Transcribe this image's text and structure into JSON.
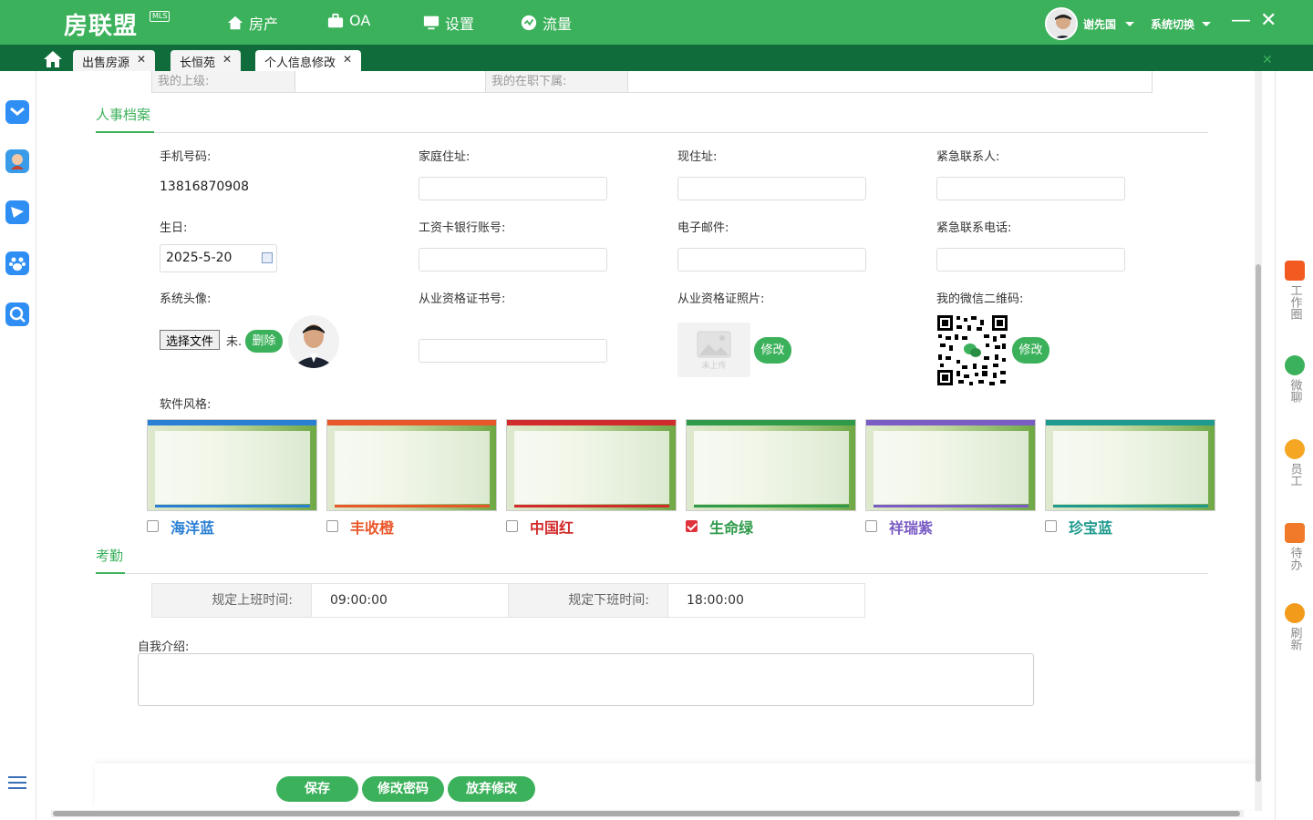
{
  "app": {
    "logo": "房联盟",
    "logo_badge": "MLS"
  },
  "nav": [
    {
      "label": "房产",
      "icon": "house-icon"
    },
    {
      "label": "OA",
      "icon": "briefcase-icon"
    },
    {
      "label": "设置",
      "icon": "monitor-icon"
    },
    {
      "label": "流量",
      "icon": "gauge-icon"
    }
  ],
  "user": {
    "name": "谢先国",
    "system_switch": "系统切换"
  },
  "tabs": [
    {
      "label": "出售房源"
    },
    {
      "label": "长恒苑"
    },
    {
      "label": "个人信息修改",
      "active": true
    }
  ],
  "top_table": {
    "superior_label": "我的上级:",
    "subordinate_label": "我的在职下属:"
  },
  "hr_section": {
    "title": "人事档案",
    "fields": {
      "phone_label": "手机号码:",
      "phone_value": "13816870908",
      "home_address_label": "家庭住址:",
      "current_address_label": "现住址:",
      "emergency_contact_label": "紧急联系人:",
      "birthday_label": "生日:",
      "birthday_value": "2025-5-20",
      "bank_account_label": "工资卡银行账号:",
      "email_label": "电子邮件:",
      "emergency_phone_label": "紧急联系电话:",
      "avatar_label": "系统头像:",
      "cert_no_label": "从业资格证书号:",
      "cert_photo_label": "从业资格证照片:",
      "wechat_qr_label": "我的微信二维码:",
      "choose_file": "选择文件",
      "no_file": "未.",
      "delete_btn": "删除",
      "modify_btn": "修改",
      "upload_placeholder": "未上传",
      "style_label": "软件风格:"
    }
  },
  "themes": [
    {
      "label": "海洋蓝",
      "color": "#2a7fd4",
      "checked": false
    },
    {
      "label": "丰收橙",
      "color": "#e8572a",
      "checked": false
    },
    {
      "label": "中国红",
      "color": "#d22b2b",
      "checked": false
    },
    {
      "label": "生命绿",
      "color": "#2f9a4a",
      "checked": true
    },
    {
      "label": "祥瑞紫",
      "color": "#7a5cc4",
      "checked": false
    },
    {
      "label": "珍宝蓝",
      "color": "#1f9a8e",
      "checked": false
    }
  ],
  "attendance": {
    "title": "考勤",
    "start_label": "规定上班时间:",
    "start_value": "09:00:00",
    "end_label": "规定下班时间:",
    "end_value": "18:00:00"
  },
  "intro": {
    "label": "自我介绍:"
  },
  "actions": {
    "save": "保存",
    "change_password": "修改密码",
    "discard": "放弃修改"
  },
  "right_rail": [
    {
      "label": "工作圈",
      "color": "#f25a22"
    },
    {
      "label": "微聊",
      "color": "#3cb15b"
    },
    {
      "label": "员工",
      "color": "#f5a623"
    },
    {
      "label": "待办",
      "color": "#f07a2a"
    },
    {
      "label": "刷新",
      "color": "#f29a1a"
    }
  ],
  "colors": {
    "brand": "#3cb15b",
    "tabbar": "#106d3b"
  }
}
